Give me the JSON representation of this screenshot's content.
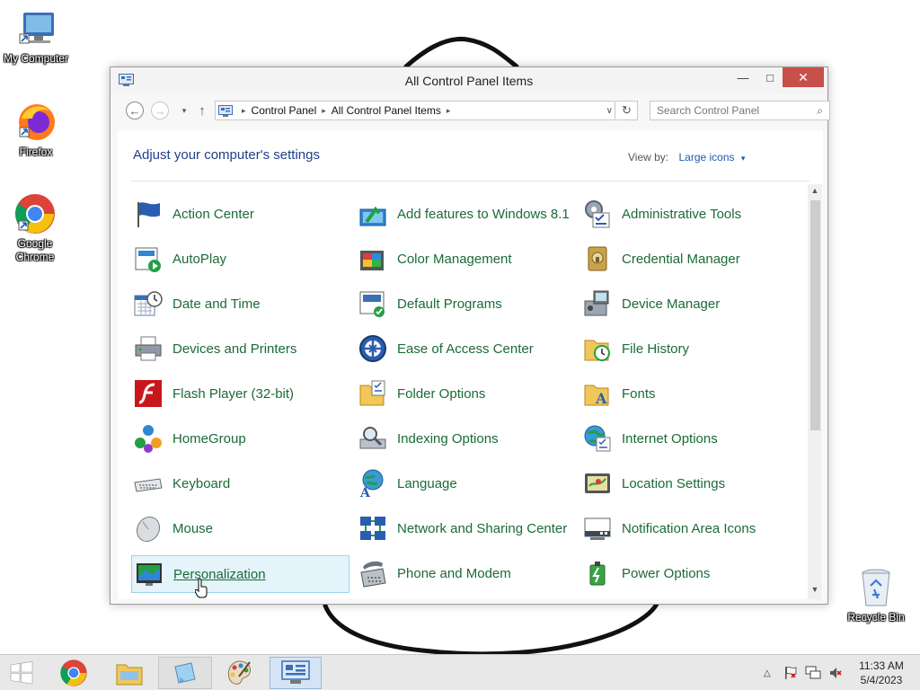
{
  "desktop": {
    "icons": [
      {
        "label": "My Computer"
      },
      {
        "label": "Firefox"
      },
      {
        "label": "Google Chrome"
      },
      {
        "label": "Recycle Bin"
      }
    ]
  },
  "window": {
    "title": "All Control Panel Items",
    "min_label": "—",
    "max_label": "□",
    "close_label": "✕"
  },
  "nav": {
    "back_icon": "←",
    "forward_icon": "→",
    "recent_icon": "▾",
    "up_icon": "↑",
    "breadcrumb": [
      "Control Panel",
      "All Control Panel Items"
    ],
    "separator": "▸",
    "dropdown_icon": "∨",
    "refresh_icon": "↻",
    "search_placeholder": "Search Control Panel",
    "search_icon": "⌕"
  },
  "content": {
    "heading": "Adjust your computer's settings",
    "view_by_label": "View by:",
    "view_by_value": "Large icons",
    "view_by_caret": "▾"
  },
  "items": [
    {
      "label": "Action Center",
      "icon": "flag-icon"
    },
    {
      "label": "Add features to Windows 8.1",
      "icon": "add-features-icon"
    },
    {
      "label": "Administrative Tools",
      "icon": "admin-tools-icon"
    },
    {
      "label": "AutoPlay",
      "icon": "autoplay-icon"
    },
    {
      "label": "Color Management",
      "icon": "color-management-icon"
    },
    {
      "label": "Credential Manager",
      "icon": "credential-manager-icon"
    },
    {
      "label": "Date and Time",
      "icon": "calendar-clock-icon"
    },
    {
      "label": "Default Programs",
      "icon": "default-programs-icon"
    },
    {
      "label": "Device Manager",
      "icon": "device-manager-icon"
    },
    {
      "label": "Devices and Printers",
      "icon": "printer-icon"
    },
    {
      "label": "Ease of Access Center",
      "icon": "ease-of-access-icon"
    },
    {
      "label": "File History",
      "icon": "file-history-icon"
    },
    {
      "label": "Flash Player (32-bit)",
      "icon": "flash-icon"
    },
    {
      "label": "Folder Options",
      "icon": "folder-options-icon"
    },
    {
      "label": "Fonts",
      "icon": "fonts-folder-icon"
    },
    {
      "label": "HomeGroup",
      "icon": "homegroup-icon"
    },
    {
      "label": "Indexing Options",
      "icon": "indexing-icon"
    },
    {
      "label": "Internet Options",
      "icon": "globe-icon"
    },
    {
      "label": "Keyboard",
      "icon": "keyboard-icon"
    },
    {
      "label": "Language",
      "icon": "language-icon"
    },
    {
      "label": "Location Settings",
      "icon": "location-icon"
    },
    {
      "label": "Mouse",
      "icon": "mouse-icon"
    },
    {
      "label": "Network and Sharing Center",
      "icon": "network-icon"
    },
    {
      "label": "Notification Area Icons",
      "icon": "notification-icon"
    },
    {
      "label": "Personalization",
      "icon": "personalization-icon"
    },
    {
      "label": "Phone and Modem",
      "icon": "phone-icon"
    },
    {
      "label": "Power Options",
      "icon": "power-icon"
    }
  ],
  "taskbar": {
    "apps": [
      {
        "name": "start-button"
      },
      {
        "name": "chrome"
      },
      {
        "name": "file-explorer"
      },
      {
        "name": "sticky"
      },
      {
        "name": "paint"
      },
      {
        "name": "control-panel"
      }
    ],
    "tray_up": "△",
    "clock_time": "11:33 AM",
    "clock_date": "5/4/2023"
  }
}
